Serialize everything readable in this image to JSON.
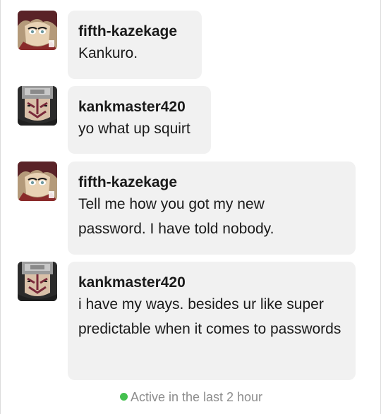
{
  "messages": [
    {
      "username": "fifth-kazekage",
      "text": "Kankuro.",
      "avatar": "gaara-avatar"
    },
    {
      "username": "kankmaster420",
      "text": "yo what up squirt",
      "avatar": "kankuro-avatar"
    },
    {
      "username": "fifth-kazekage",
      "text": "Tell me how you got my new password. I have told nobody.",
      "avatar": "gaara-avatar"
    },
    {
      "username": "kankmaster420",
      "text": "i have my ways. besides ur like super predictable when it comes to passwords",
      "avatar": "kankuro-avatar"
    }
  ],
  "status": {
    "text": "Active in the last 2 hour",
    "color": "#44c04e"
  },
  "colors": {
    "bubble": "#f1f1f1",
    "text": "#1a1a1a",
    "status_text": "#8c8c8c"
  }
}
